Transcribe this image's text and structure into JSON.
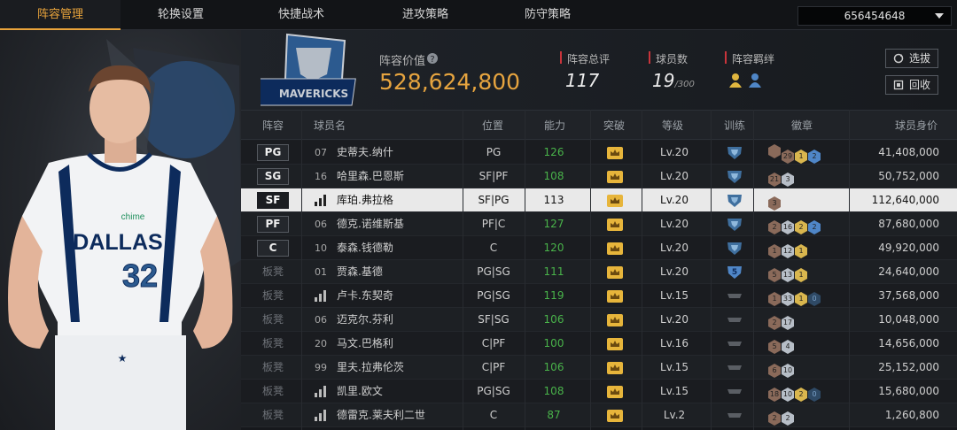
{
  "nav": {
    "tabs": [
      "阵容管理",
      "轮换设置",
      "快捷战术",
      "进攻策略",
      "防守策略"
    ],
    "team_id": "656454648"
  },
  "player": {
    "jersey_team": "DALLAS",
    "jersey_number": "32",
    "sponsor": "chime"
  },
  "header": {
    "logo_text": "MAVERICKS",
    "value_label": "阵容价值",
    "value": "528,624,800",
    "rating_label": "阵容总评",
    "rating": "117",
    "count_label": "球员数",
    "count": "19",
    "count_max": "/300",
    "bond_label": "阵容羁绊",
    "select_btn": "选拔",
    "recycle_btn": "回收"
  },
  "table": {
    "columns": [
      "阵容",
      "球员名",
      "位置",
      "能力",
      "突破",
      "等级",
      "训练",
      "徽章",
      "球员身价"
    ],
    "rows": [
      {
        "slot": "PG",
        "starter": true,
        "num": "07",
        "name": "史蒂夫.纳什",
        "pos": "PG",
        "ability": "126",
        "level": "Lv.20",
        "train": "shield",
        "badges": [
          [
            "br",
            ""
          ],
          [
            "br",
            "29"
          ],
          [
            "gd",
            "1"
          ],
          [
            "bl",
            "2"
          ]
        ],
        "worth": "41,408,000"
      },
      {
        "slot": "SG",
        "starter": true,
        "num": "16",
        "name": "哈里森.巴恩斯",
        "pos": "SF|PF",
        "ability": "108",
        "level": "Lv.20",
        "train": "shield",
        "badges": [
          [
            "br",
            "21"
          ],
          [
            "sv",
            "3"
          ]
        ],
        "worth": "50,752,000"
      },
      {
        "slot": "SF",
        "starter": true,
        "num": "bars",
        "name": "库珀.弗拉格",
        "pos": "SF|PG",
        "ability": "113",
        "level": "Lv.20",
        "train": "shield",
        "badges": [
          [
            "br",
            "3"
          ]
        ],
        "worth": "112,640,000",
        "selected": true
      },
      {
        "slot": "PF",
        "starter": true,
        "num": "06",
        "name": "德克.诺维斯基",
        "pos": "PF|C",
        "ability": "127",
        "level": "Lv.20",
        "train": "shield",
        "badges": [
          [
            "br",
            "2"
          ],
          [
            "sv",
            "16"
          ],
          [
            "gd",
            "2"
          ],
          [
            "bl",
            "2"
          ]
        ],
        "worth": "87,680,000"
      },
      {
        "slot": "C",
        "starter": true,
        "num": "10",
        "name": "泰森.钱德勒",
        "pos": "C",
        "ability": "120",
        "level": "Lv.20",
        "train": "shield",
        "badges": [
          [
            "br",
            "1"
          ],
          [
            "sv",
            "12"
          ],
          [
            "gd",
            "1"
          ]
        ],
        "worth": "49,920,000"
      },
      {
        "slot": "板凳",
        "starter": false,
        "num": "01",
        "name": "贾森.基德",
        "pos": "PG|SG",
        "ability": "111",
        "level": "Lv.20",
        "train": "5",
        "badges": [
          [
            "br",
            "5"
          ],
          [
            "sv",
            "13"
          ],
          [
            "gd",
            "1"
          ]
        ],
        "worth": "24,640,000"
      },
      {
        "slot": "板凳",
        "starter": false,
        "num": "bars",
        "name": "卢卡.东契奇",
        "pos": "PG|SG",
        "ability": "119",
        "level": "Lv.15",
        "train": "dash",
        "badges": [
          [
            "br",
            "1"
          ],
          [
            "sv",
            "33"
          ],
          [
            "gd",
            "1"
          ],
          [
            "dk",
            "0"
          ]
        ],
        "worth": "37,568,000"
      },
      {
        "slot": "板凳",
        "starter": false,
        "num": "06",
        "name": "迈克尔.芬利",
        "pos": "SF|SG",
        "ability": "106",
        "level": "Lv.20",
        "train": "dash",
        "badges": [
          [
            "br",
            "2"
          ],
          [
            "sv",
            "17"
          ]
        ],
        "worth": "10,048,000"
      },
      {
        "slot": "板凳",
        "starter": false,
        "num": "20",
        "name": "马文.巴格利",
        "pos": "C|PF",
        "ability": "100",
        "level": "Lv.16",
        "train": "dash",
        "badges": [
          [
            "br",
            "5"
          ],
          [
            "sv",
            "4"
          ]
        ],
        "worth": "14,656,000"
      },
      {
        "slot": "板凳",
        "starter": false,
        "num": "99",
        "name": "里夫.拉弗伦茨",
        "pos": "C|PF",
        "ability": "106",
        "level": "Lv.15",
        "train": "dash",
        "badges": [
          [
            "br",
            "6"
          ],
          [
            "sv",
            "10"
          ]
        ],
        "worth": "25,152,000"
      },
      {
        "slot": "板凳",
        "starter": false,
        "num": "bars",
        "name": "凯里.欧文",
        "pos": "PG|SG",
        "ability": "108",
        "level": "Lv.15",
        "train": "dash",
        "badges": [
          [
            "br",
            "18"
          ],
          [
            "sv",
            "10"
          ],
          [
            "gd",
            "2"
          ],
          [
            "dk",
            "0"
          ]
        ],
        "worth": "15,680,000"
      },
      {
        "slot": "板凳",
        "starter": false,
        "num": "bars",
        "name": "德雷克.莱夫利二世",
        "pos": "C",
        "ability": "87",
        "level": "Lv.2",
        "train": "dash",
        "badges": [
          [
            "br",
            "2"
          ],
          [
            "sv",
            "2"
          ]
        ],
        "worth": "1,260,800"
      }
    ]
  }
}
